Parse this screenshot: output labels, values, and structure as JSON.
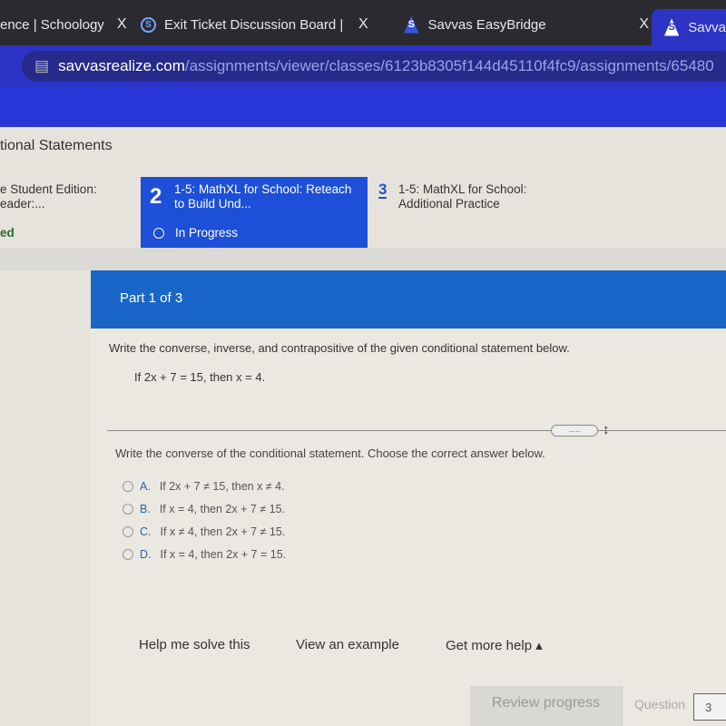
{
  "browser": {
    "tabs": [
      {
        "title": "ence | Schoology",
        "icon": "none"
      },
      {
        "title": "Exit Ticket Discussion Board | S",
        "icon": "schoology-icon"
      },
      {
        "title": "Savvas EasyBridge",
        "icon": "savvas-icon"
      },
      {
        "title": "Savva",
        "icon": "savvas-icon"
      }
    ],
    "close": "X",
    "url_host": "savvasrealize.com",
    "url_path": "/assignments/viewer/classes/6123b8305f144d45110f4fc9/assignments/65480"
  },
  "lesson": {
    "title": "tional Statements",
    "items": [
      {
        "title": "e Student Edition:\neader:...",
        "status": "ed"
      },
      {
        "number": "2",
        "title": "1-5: MathXL for School: Reteach to Build Und...",
        "status": "In Progress"
      },
      {
        "number": "3",
        "title": "1-5: MathXL for School: Additional Practice"
      }
    ]
  },
  "question": {
    "part": "Part 1 of 3",
    "prompt": "Write the converse, inverse, and contrapositive of the given conditional statement below.",
    "statement": "If 2x + 7 = 15, then x = 4.",
    "handle": ".....",
    "subprompt": "Write the converse of the conditional statement. Choose the correct answer below.",
    "options": [
      {
        "label": "A.",
        "text": "If 2x + 7 ≠ 15, then x ≠ 4."
      },
      {
        "label": "B.",
        "text": "If x = 4, then 2x + 7 ≠ 15."
      },
      {
        "label": "C.",
        "text": "If x ≠ 4, then 2x + 7 ≠ 15."
      },
      {
        "label": "D.",
        "text": "If x = 4, then 2x + 7 = 15."
      }
    ]
  },
  "help": {
    "solve": "Help me solve this",
    "example": "View an example",
    "more": "Get more help ▴"
  },
  "footer": {
    "review": "Review progress",
    "question_label": "Question",
    "question_value": "3"
  },
  "colors": {
    "accent": "#1d4fd8",
    "part_header": "#1a66c8",
    "browser_blue": "#2d33c4"
  }
}
